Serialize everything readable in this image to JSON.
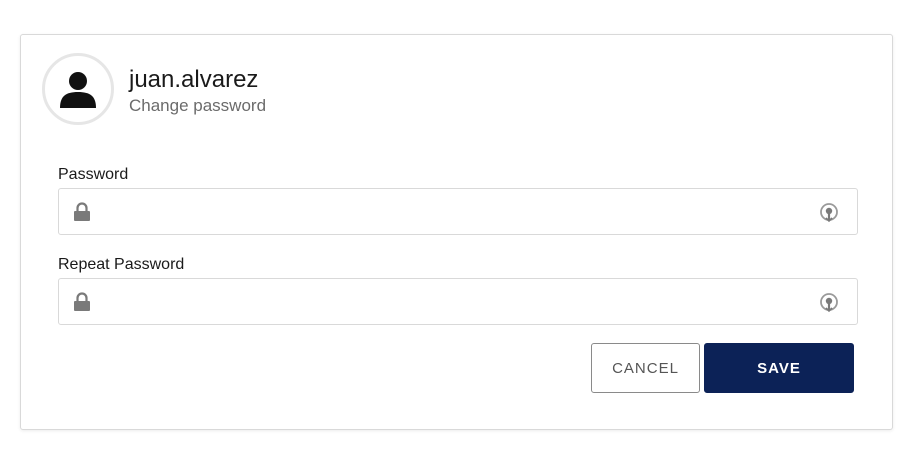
{
  "header": {
    "username": "juan.alvarez",
    "subtitle": "Change password"
  },
  "form": {
    "password_label": "Password",
    "password_value": "",
    "repeat_password_label": "Repeat Password",
    "repeat_password_value": ""
  },
  "actions": {
    "cancel_label": "CANCEL",
    "save_label": "SAVE"
  },
  "icons": {
    "avatar": "user-icon",
    "field_leading": "lock-icon",
    "field_trailing": "eye-icon"
  },
  "colors": {
    "primary": "#0c2257",
    "border": "#d9d9d9",
    "icon": "#7a7a7a"
  }
}
